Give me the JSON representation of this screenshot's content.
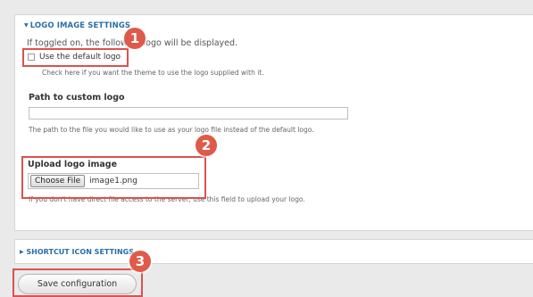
{
  "logo_settings": {
    "legend": "LOGO IMAGE SETTINGS",
    "description": "If toggled on, the following logo will be displayed.",
    "default_logo_checkbox": {
      "label": "Use the default logo",
      "checked": false
    },
    "default_logo_hint": "Check here if you want the theme to use the logo supplied with it.",
    "custom_logo": {
      "label": "Path to custom logo",
      "value": "",
      "hint": "The path to the file you would like to use as your logo file instead of the default logo."
    },
    "upload": {
      "label": "Upload logo image",
      "button_label": "Choose File",
      "file_name": "image1.png",
      "hint": "If you don't have direct file access to the server, use this field to upload your logo."
    }
  },
  "shortcut_icon": {
    "legend": "SHORTCUT ICON SETTINGS"
  },
  "actions": {
    "save_label": "Save configuration"
  },
  "annotations": {
    "badge1": "1",
    "badge2": "2",
    "badge3": "3",
    "color": "#e05a4a"
  }
}
